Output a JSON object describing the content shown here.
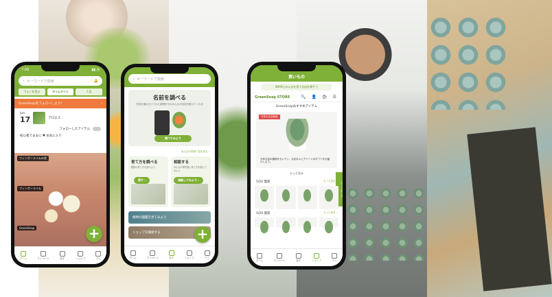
{
  "phone1": {
    "status_time": "7:09",
    "search_placeholder": "キーワードで検索",
    "tabs": [
      "フォトを見る",
      "タイムライン",
      "人気"
    ],
    "banner_text": "GreenSnapをフォローしよう！",
    "banner_arrow": "›",
    "date_month": "Jun.",
    "date_day": "17",
    "plant_name": "アロエス",
    "follow_label": "フォローしたアイテム",
    "user_line": "初心者でままに ♥ お気に入り",
    "tag_top": "フィンガーライムの花",
    "tag_mid": "フィンガーライム",
    "tag_bottom": "GreenSnap",
    "fab_label": "+",
    "nav": [
      "ホーム",
      "マイページ",
      "探す",
      "ショップ",
      "マイ"
    ]
  },
  "phone2": {
    "search_placeholder": "キーワードで検索",
    "hero_title": "名前を調べる",
    "hero_sub": "写真を撮るだけでAIと植物好きのみんなが名前を教えてくれる",
    "hero_button": "調べてみよう",
    "link_text": "みんなの質問一覧を見る ›",
    "card1_title": "育て方を調べる",
    "card1_sub": "植物の育て方を調べよう",
    "card1_button": "探す ›",
    "card2_title": "相談する",
    "card2_sub": "みんなや専門家に育て方を聞いてみよう",
    "card2_button": "相談してみよう ›",
    "teal_text": "植物の図鑑を見てみよう",
    "brown_text": "ショップを検索する",
    "fab_label": "+",
    "nav": [
      "ホーム",
      "マイページ",
      "探す",
      "ショップ",
      "マイ"
    ]
  },
  "phone3": {
    "header_title": "買いもの",
    "tip": "SNAPにみんなを見てお店を探そう",
    "store_logo": "GreenSnap STORE",
    "store_icons": "🔍 👤 🛍 ☰",
    "recommend_title": "GreenSnapおすすめアイテム",
    "red_tag": "今年の注目商品",
    "feature_text": "今年注目の植物をセレクト。大切な人にグリーンのギフトをお届けしよう。",
    "side_label": "ショッピング",
    "more_label": "もっと見る",
    "section1": "5/20 発売",
    "section1_more": "もっと見る ›",
    "section2": "5/20 発売",
    "section2_more": "もっと見る ›",
    "nav": [
      "ホーム",
      "マイページ",
      "探す",
      "ショップ",
      "マイ"
    ]
  }
}
